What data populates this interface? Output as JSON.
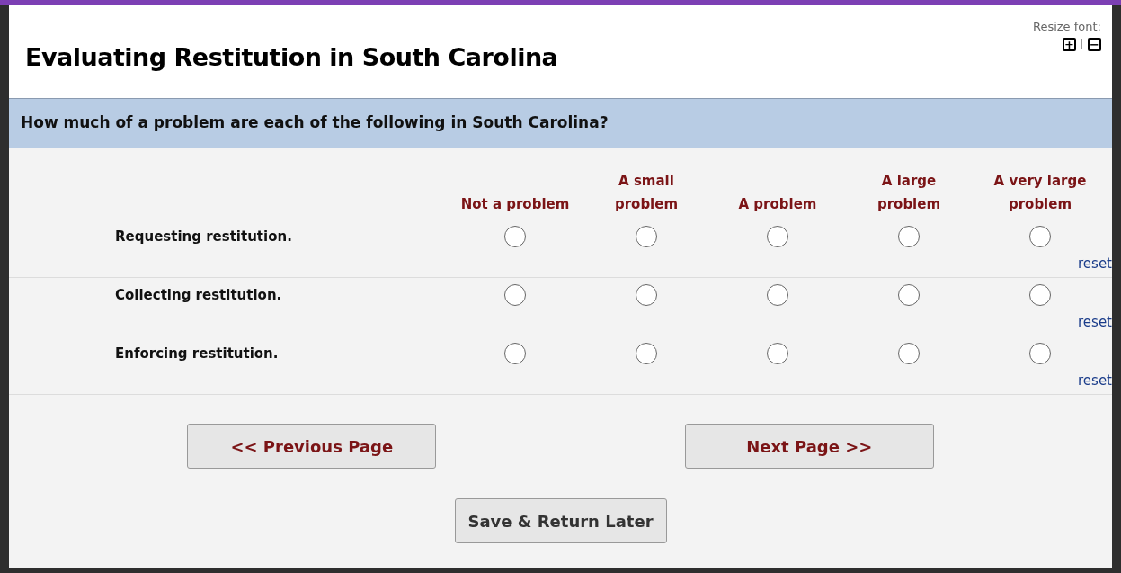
{
  "header": {
    "title": "Evaluating Restitution in South Carolina",
    "resize_font": {
      "label": "Resize font:",
      "increase": "+",
      "decrease": "−"
    }
  },
  "question": "How much of a problem are each of the following in South Carolina?",
  "columns": [
    "Not a problem",
    "A small problem",
    "A problem",
    "A large problem",
    "A very large problem"
  ],
  "rows": [
    {
      "label": "Requesting restitution.",
      "options": [
        {
          "selected": false
        },
        {
          "selected": false
        },
        {
          "selected": false
        },
        {
          "selected": false
        },
        {
          "selected": false
        }
      ],
      "reset": "reset"
    },
    {
      "label": "Collecting restitution.",
      "options": [
        {
          "selected": false
        },
        {
          "selected": false
        },
        {
          "selected": false
        },
        {
          "selected": false
        },
        {
          "selected": false
        }
      ],
      "reset": "reset"
    },
    {
      "label": "Enforcing restitution.",
      "options": [
        {
          "selected": false
        },
        {
          "selected": false
        },
        {
          "selected": false
        },
        {
          "selected": false
        },
        {
          "selected": false
        }
      ],
      "reset": "reset"
    }
  ],
  "buttons": {
    "previous": "<< Previous Page",
    "next": "Next Page >>",
    "save": "Save & Return Later"
  }
}
